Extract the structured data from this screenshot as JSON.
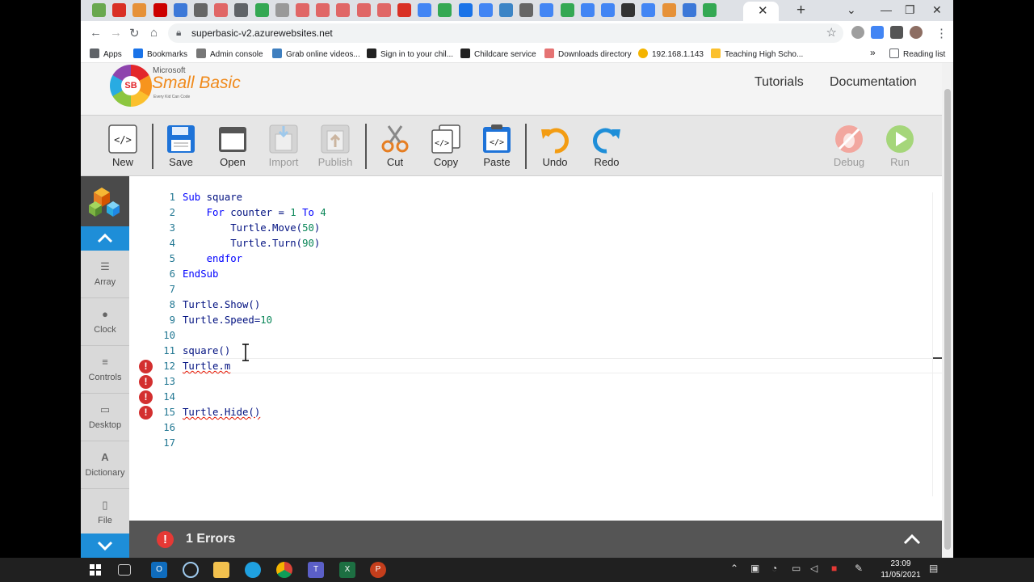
{
  "browser": {
    "url": "superbasic-v2.azurewebsites.net",
    "bookmarks": [
      "Apps",
      "Bookmarks",
      "Admin console",
      "Grab online videos...",
      "Sign in to your chil...",
      "Childcare service",
      "Downloads directory",
      "192.168.1.143",
      "Teaching High Scho...",
      "Reading list"
    ],
    "overflow_label": "»"
  },
  "site": {
    "logo_microsoft": "Microsoft",
    "logo_name": "Small Basic",
    "logo_tagline": "Every Kid Can Code",
    "logo_glyph": "SB",
    "nav": [
      "Tutorials",
      "Documentation"
    ]
  },
  "toolbar": {
    "buttons": [
      {
        "label": "New",
        "enabled": true,
        "icon": "code-file-icon"
      },
      {
        "label": "Save",
        "enabled": true,
        "icon": "floppy-disk-icon"
      },
      {
        "label": "Open",
        "enabled": true,
        "icon": "folder-icon"
      },
      {
        "label": "Import",
        "enabled": false,
        "icon": "import-icon"
      },
      {
        "label": "Publish",
        "enabled": false,
        "icon": "publish-icon"
      },
      {
        "label": "Cut",
        "enabled": true,
        "icon": "scissors-icon"
      },
      {
        "label": "Copy",
        "enabled": true,
        "icon": "copy-icon"
      },
      {
        "label": "Paste",
        "enabled": true,
        "icon": "paste-icon"
      },
      {
        "label": "Undo",
        "enabled": true,
        "icon": "undo-arrow-icon"
      },
      {
        "label": "Redo",
        "enabled": true,
        "icon": "redo-arrow-icon"
      },
      {
        "label": "Debug",
        "enabled": false,
        "icon": "bug-icon"
      },
      {
        "label": "Run",
        "enabled": false,
        "icon": "play-icon"
      }
    ]
  },
  "sidebar": {
    "items": [
      {
        "label": "Array",
        "icon": "list-icon"
      },
      {
        "label": "Clock",
        "icon": "clock-icon"
      },
      {
        "label": "Controls",
        "icon": "sliders-icon"
      },
      {
        "label": "Desktop",
        "icon": "monitor-icon"
      },
      {
        "label": "Dictionary",
        "icon": "letter-a-icon"
      },
      {
        "label": "File",
        "icon": "file-icon"
      }
    ]
  },
  "editor": {
    "lines": [
      {
        "n": "1",
        "text": "Sub square",
        "error": false
      },
      {
        "n": "2",
        "text": "    For counter = 1 To 4",
        "error": false
      },
      {
        "n": "3",
        "text": "        Turtle.Move(50)",
        "error": false
      },
      {
        "n": "4",
        "text": "        Turtle.Turn(90)",
        "error": false
      },
      {
        "n": "5",
        "text": "    endfor",
        "error": false
      },
      {
        "n": "6",
        "text": "EndSub",
        "error": false
      },
      {
        "n": "7",
        "text": "",
        "error": false
      },
      {
        "n": "8",
        "text": "Turtle.Show()",
        "error": false
      },
      {
        "n": "9",
        "text": "Turtle.Speed=10",
        "error": false
      },
      {
        "n": "10",
        "text": "",
        "error": false
      },
      {
        "n": "11",
        "text": "square()",
        "error": false
      },
      {
        "n": "12",
        "text": "Turtle.m",
        "error": true
      },
      {
        "n": "13",
        "text": "",
        "error": true
      },
      {
        "n": "14",
        "text": "",
        "error": true
      },
      {
        "n": "15",
        "text": "Turtle.Hide()",
        "error": true
      },
      {
        "n": "16",
        "text": "",
        "error": false
      },
      {
        "n": "17",
        "text": "",
        "error": false
      }
    ]
  },
  "errors": {
    "summary": "1 Errors"
  },
  "taskbar": {
    "time": "23:09",
    "date": "11/05/2021"
  },
  "colors": {
    "accent": "#1e8ed8",
    "error": "#d32f2f",
    "keyword": "#0000ff",
    "number": "#098658",
    "identifier": "#001080"
  }
}
